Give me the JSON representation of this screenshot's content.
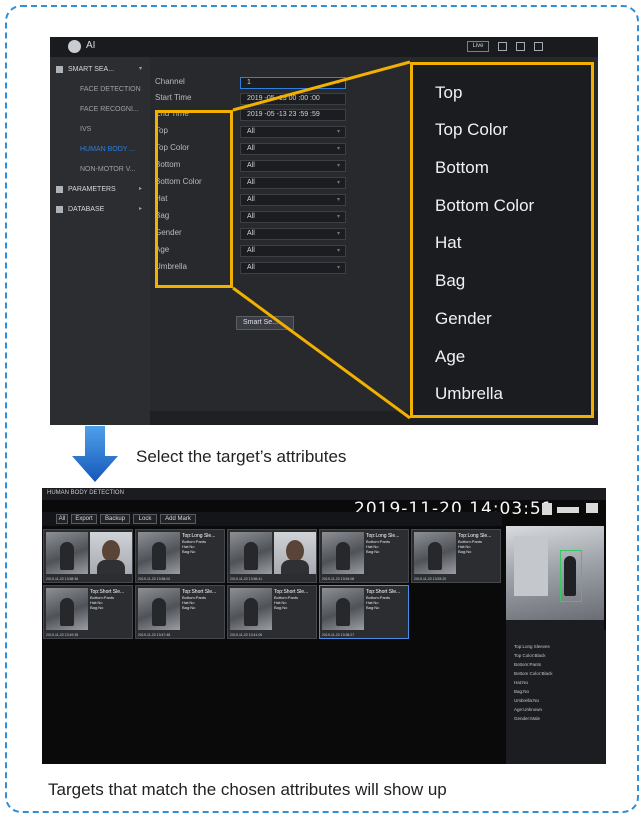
{
  "top_screen": {
    "app_title": "AI",
    "live_label": "Live",
    "sidebar": [
      {
        "label": "SMART SEA...",
        "type": "main",
        "icon": "person-icon",
        "caret": "▾"
      },
      {
        "label": "FACE DETECTION",
        "type": "sub"
      },
      {
        "label": "FACE RECOGNI...",
        "type": "sub"
      },
      {
        "label": "IVS",
        "type": "sub"
      },
      {
        "label": "HUMAN BODY ...",
        "type": "sub",
        "active": true
      },
      {
        "label": "NON-MOTOR V...",
        "type": "sub"
      },
      {
        "label": "PARAMETERS",
        "type": "main",
        "icon": "list-icon",
        "caret": "▸"
      },
      {
        "label": "DATABASE",
        "type": "main",
        "icon": "database-icon",
        "caret": "▸"
      }
    ],
    "fields": [
      {
        "label": "Channel",
        "value": "1"
      },
      {
        "label": "Start Time",
        "value": "2019 -05 -13    00 :00 :00"
      },
      {
        "label": "End Time",
        "value": "2019 -05 -13    23 :59 :59"
      },
      {
        "label": "Top",
        "value": "All"
      },
      {
        "label": "Top Color",
        "value": "All"
      },
      {
        "label": "Bottom",
        "value": "All"
      },
      {
        "label": "Bottom Color",
        "value": "All"
      },
      {
        "label": "Hat",
        "value": "All"
      },
      {
        "label": "Bag",
        "value": "All"
      },
      {
        "label": "Gender",
        "value": "All"
      },
      {
        "label": "Age",
        "value": "All"
      },
      {
        "label": "Umbrella",
        "value": "All"
      }
    ],
    "smart_search_label": "Smart Se..."
  },
  "zoom_labels": [
    "Top",
    "Top Color",
    "Bottom",
    "Bottom Color",
    "Hat",
    "Bag",
    "Gender",
    "Age",
    "Umbrella"
  ],
  "caption_select": "Select the target’s attributes",
  "caption_result": "Targets that match the chosen attributes will show up",
  "bottom_screen": {
    "title": "HUMAN BODY DETECTION",
    "timestamp": "2019-11-20 14:03:51",
    "toolbar": [
      "All",
      "Export",
      "Backup",
      "Lock",
      "Add Mark"
    ],
    "thumbnails": [
      {
        "kind": "face",
        "time": "2019-11-20 13:58:36",
        "lines": []
      },
      {
        "kind": "body",
        "time": "2019-11-20 13:58:02",
        "lines": [
          "Top:Long Sle...",
          "Bottom:Pants",
          "Hat:No",
          "Bag:No"
        ]
      },
      {
        "kind": "face",
        "time": "2019-11-20 13:56:41",
        "lines": []
      },
      {
        "kind": "body",
        "time": "2019-11-20 13:54:08",
        "lines": [
          "Top:Long Sle...",
          "Bottom:Pants",
          "Hat:No",
          "Bag:No"
        ]
      },
      {
        "kind": "body",
        "time": "2019-11-20 13:53:20",
        "lines": [
          "Top:Long Sle...",
          "Bottom:Pants",
          "Hat:No",
          "Bag:No"
        ]
      },
      {
        "kind": "body",
        "time": "2019-11-20 13:49:35",
        "lines": [
          "Top:Short Sle...",
          "Bottom:Pants",
          "Hat:No",
          "Bag:No"
        ]
      },
      {
        "kind": "body",
        "time": "2019-11-20 13:47:48",
        "lines": [
          "Top:Short Sle...",
          "Bottom:Pants",
          "Hat:No",
          "Bag:No"
        ]
      },
      {
        "kind": "body",
        "time": "2019-11-20 13:41:06",
        "lines": [
          "Top:Short Sle...",
          "Bottom:Pants",
          "Hat:No",
          "Bag:No"
        ]
      },
      {
        "kind": "body",
        "time": "2019-11-20 13:38:27",
        "lines": [
          "Top:Short Sle...",
          "Bottom:Pants",
          "Hat:No",
          "Bag:No"
        ],
        "selected": true
      }
    ],
    "attributes": [
      "Top:Long Sleeves",
      "Top Color:Black",
      "Bottom:Pants",
      "Bottom Color:Black",
      "Hat:No",
      "Bag:No",
      "Umbrella:No",
      "Age:Unknown",
      "Gender:Male"
    ]
  },
  "colors": {
    "highlight": "#f2b100",
    "frame": "#2f8fd8",
    "arrow": "#1d6fd0",
    "active": "#2f7fe0"
  }
}
